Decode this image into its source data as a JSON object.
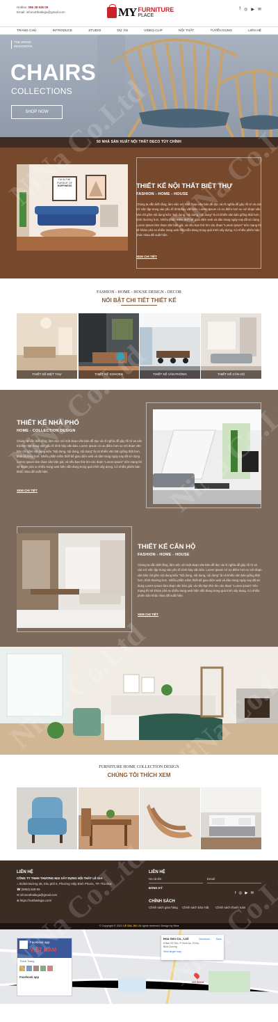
{
  "header": {
    "hotline_label": "Hotline:",
    "hotline": "096 38 636 09",
    "email_label": "Email:",
    "email": "infomotthatlega@gmail.com",
    "logo_my": "MY",
    "logo_line1": "FURNITURE",
    "logo_line2": "PLACE",
    "social": [
      "f",
      "◎",
      "▶",
      "✉"
    ]
  },
  "nav": [
    "TRANG CHỦ",
    "INTRODUCE",
    "STUDIO",
    "DỰ ÁN",
    "VIDEO CLIP",
    "NỘI THẤT",
    "TUYỂN DỤNG",
    "LIÊN HỆ"
  ],
  "hero": {
    "tag_line1": "THE WOOD",
    "tag_line2": "DESIGNERS",
    "title": "CHAIRS",
    "subtitle": "COLLECTIONS",
    "button": "SHOP NOW"
  },
  "slogan": "50 NHÀ SẢN XUẤT NỘI THẤT DECO TÙY CHỈNH",
  "villa": {
    "title": "THIẾT KẾ NỘI THẤT BIỆT THỰ",
    "sub": "FASHION - HOME - HOUSE",
    "body": "Chúng ta vẫn biết rằng, làm việc với một đoạn văn bản dễ đọc và rõ nghĩa dễ gây rối trí và cản trở việc tập trung vào yếu tố trình bày văn bản. Lorem Ipsum có ưu điểm hơn so với đoạn văn bản chỉ gồm nội dung kiểu \"Nội dung, nội dung, nội dung\" là nó khiến văn bản giống thật hơn, bình thường hơn. Nhiều phần mềm thiết kế giao diện web và dàn trang ngày nay đã sử dụng Lorem Ipsum làm đoạn văn bản giả, và nếu bạn thử tìm các đoạn \"Lorem ipsum\" trên mạng thì sẽ khám phá ra nhiều trang web hiện vẫn đang trong quá trình xây dựng. Có nhiều phiên bản khác nhau đã xuất hiện.",
    "link": "XEM CHI TIẾT",
    "poster_line1": "I'M IN THE",
    "poster_line2": "PURSUIT OF",
    "poster_line3": "HAPPINESS"
  },
  "feature": {
    "kicker": "FASHION - HOME - HOUSE DESIGN - DECOR",
    "title": "NỔI BẬT CHI TIẾT THIẾT KẾ",
    "tiles": [
      "THIẾT KẾ BIỆT THỰ",
      "THIẾT KẾ SOHOEN",
      "THIẾT KẾ VĂN PHÒNG",
      "THIẾT KẾ CĂN HỘ"
    ]
  },
  "townhouse": {
    "title": "THIẾT KẾ NHÀ PHỐ",
    "sub": "HOME - COLLECTION DESIGN",
    "body": "Chúng ta vẫn biết rằng, làm việc với một đoạn văn bản dễ đọc và rõ nghĩa dễ gây rối trí và cản trở việc tập trung vào yếu tố trình bày văn bản. Lorem Ipsum có ưu điểm hơn so với đoạn văn bản chỉ gồm nội dung kiểu \"Nội dung, nội dung, nội dung\" là nó khiến văn bản giống thật hơn, bình thường hơn. Nhiều phần mềm thiết kế giao diện web và dàn trang ngày nay đã sử dụng Lorem Ipsum làm đoạn văn bản giả, và nếu bạn thử tìm các đoạn \"Lorem ipsum\" trên mạng thì sẽ khám phá ra nhiều trang web hiện vẫn đang trong quá trình xây dựng. Có nhiều phiên bản khác nhau đã xuất hiện.",
    "link": "XEM CHI TIẾT"
  },
  "apartment": {
    "title": "THIẾT KẾ CĂN HỘ",
    "sub": "FASHION - HOME - HOUSE",
    "body": "Chúng ta vẫn biết rằng, làm việc với một đoạn văn bản dễ đọc và rõ nghĩa dễ gây rối trí và cản trở việc tập trung vào yếu tố trình bày văn bản. Lorem Ipsum có ưu điểm hơn so với đoạn văn bản chỉ gồm nội dung kiểu \"Nội dung, nội dung, nội dung\" là nó khiến văn bản giống thật hơn, bình thường hơn. Nhiều phần mềm thiết kế giao diện web và dàn trang ngày nay đã sử dụng Lorem Ipsum làm đoạn văn bản giả, và nếu bạn thử tìm các đoạn \"Lorem ipsum\" trên mạng thì sẽ khám phá ra nhiều trang web hiện vẫn đang trong quá trình xây dựng. Có nhiều phiên bản khác nhau đã xuất hiện.",
    "link": "XEM CHI TIẾT"
  },
  "like": {
    "kicker": "FURNITURE HOME COLLECTION DESIGN",
    "title": "CHÚNG TÔI THÍCH XEM"
  },
  "footer": {
    "contact_title": "LIÊN HỆ",
    "company": "CÔNG TY TNHH THƯƠNG MẠI XÂY DỰNG NỘI THẤT LÊ GIA",
    "address": "91/5/6 Đường 48, Khu phố 6, Phường Hiệp Bình Phước, TP. Thủ Đức",
    "phone": "(0963) 628-09",
    "email": "infomotthatlega@gmail.com",
    "web": "https://noithatlegia.com/",
    "form_title": "LIÊN HỆ",
    "name_placeholder": "Họ và tên",
    "email_placeholder": "Email",
    "submit": "ĐĂNG KÝ",
    "policy_title": "CHÍNH SÁCH",
    "policy_1": "Chính sách giao hàng",
    "policy_2": "Chính sách bảo mật",
    "policy_3": "Chính sách thanh toán"
  },
  "copyright": {
    "prefix": "© Copyright © 2021",
    "brand": "LÊ GIA JSC",
    "suffix": "All rights reserved. Design by Nina"
  },
  "map": {
    "fb_title": "Facebook app",
    "fb_name": "VIỆT NAM",
    "fb_like": "Thích Trang",
    "fb_title2": "Facebook app",
    "card_title": "Hoa Sen Co., Ltd",
    "card_addr": "8 Bác Sĩ Tịnh, P. Bình An, Dĩ An, Bình Dương",
    "card_link": "View larger map",
    "directions": "Directions",
    "save": "Save",
    "pin_label": "123 Street"
  },
  "watermark": "NiNa Co.Ltd",
  "colors": {
    "accent_red": "#c8232b",
    "section_brown": "#76492d",
    "section_taupe": "#7c6b5d",
    "footer": "#3b2c24",
    "heading_brown": "#8a5a34"
  }
}
